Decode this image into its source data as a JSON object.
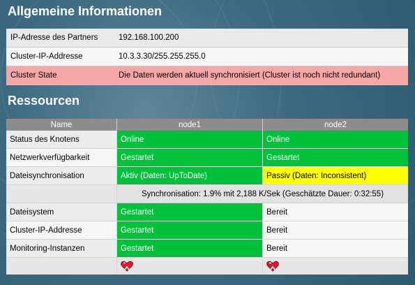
{
  "sections": {
    "info_title": "Allgemeine Informationen",
    "resources_title": "Ressourcen"
  },
  "info": [
    {
      "label": "IP-Adresse des Partners",
      "value": "192.168.100.200"
    },
    {
      "label": "Cluster-IP-Addresse",
      "value": "10.3.3.30/255.255.255.0"
    },
    {
      "label": "Cluster State",
      "value": "Die Daten werden aktuell synchronisiert (Cluster ist noch nicht redundant)"
    }
  ],
  "resources": {
    "headers": [
      "Name",
      "node1",
      "node2"
    ],
    "rows": [
      {
        "name": "Status des Knotens",
        "node1": "Online",
        "node2": "Online"
      },
      {
        "name": "Netzwerkverfügbarkeit",
        "node1": "Gestartet",
        "node2": "Gestartet"
      },
      {
        "name": "Dateisynchronisation",
        "node1": "Aktiv (Daten: UpToDate)",
        "node2": "Passiv (Daten: Inconsistent)"
      },
      {
        "sync": "Synchronisation: 1.9% mit 2,188 K/Sek (Geschätzte Dauer: 0:32:55)"
      },
      {
        "name": "Dateisystem",
        "node1": "Gestartet",
        "node2": "Bereit"
      },
      {
        "name": "Cluster-IP-Addresse",
        "node1": "Gestartet",
        "node2": "Bereit"
      },
      {
        "name": "Monitoring-Instanzen",
        "node1": "Gestartet",
        "node2": "Bereit"
      }
    ],
    "action_icons": [
      "heart-action-icon",
      "heart-action-icon"
    ]
  },
  "colors": {
    "green": "#00c23a",
    "yellow": "#ffff00",
    "alert": "#f7a6a6",
    "header": "#8c8c8c"
  }
}
